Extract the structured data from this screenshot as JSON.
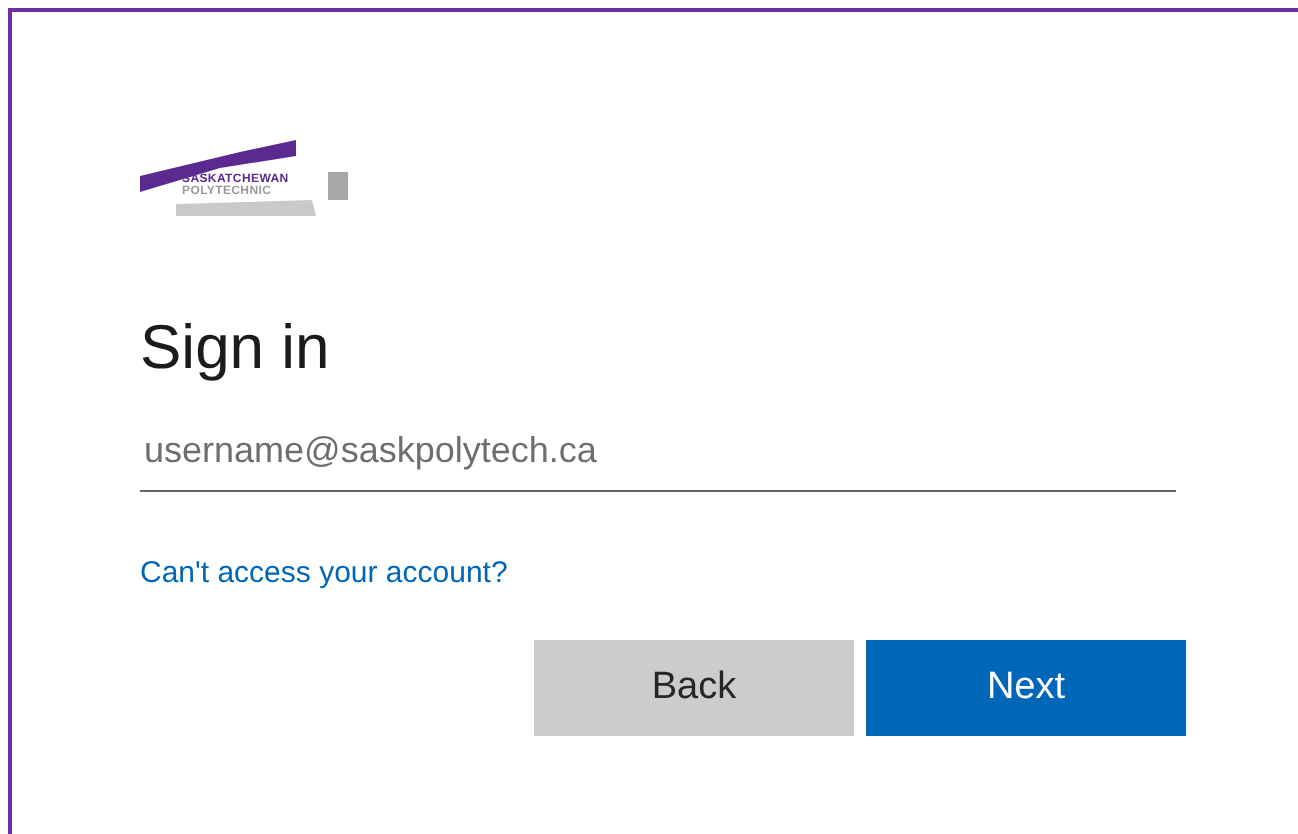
{
  "logo": {
    "lines": [
      "SASKATCHEWAN",
      "POLYTECHNIC"
    ]
  },
  "title": "Sign in",
  "email_field": {
    "placeholder": "username@saskpolytech.ca"
  },
  "help_link": "Can't access your account?",
  "buttons": [
    {
      "label": "Back",
      "kind": "secondary"
    },
    {
      "label": "Next",
      "kind": "primary"
    }
  ]
}
